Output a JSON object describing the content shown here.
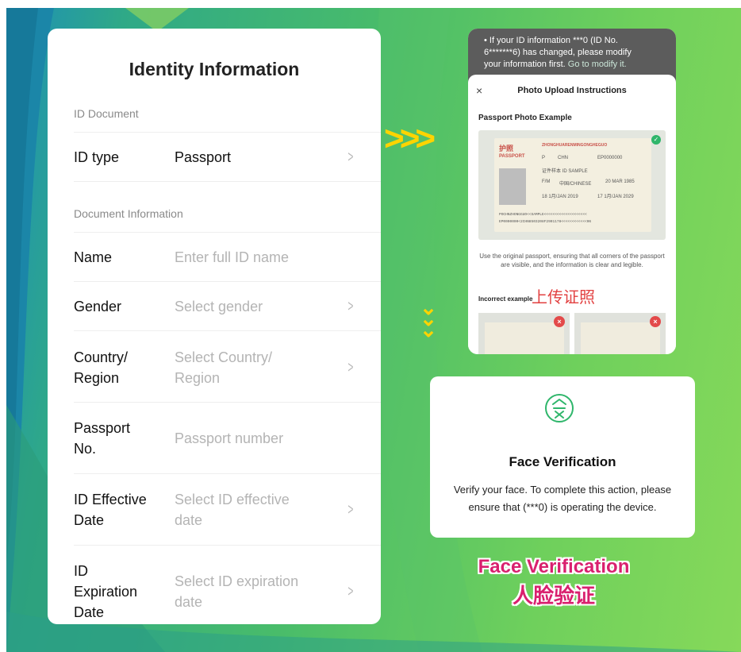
{
  "id_form": {
    "title": "Identity Information",
    "section_id_document": "ID Document",
    "id_type_label": "ID type",
    "id_type_value": "Passport",
    "section_document_info": "Document Information",
    "name_label": "Name",
    "name_placeholder": "Enter full ID name",
    "gender_label": "Gender",
    "gender_placeholder": "Select gender",
    "country_label_1": "Country/",
    "country_label_2": "Region",
    "country_placeholder_1": "Select Country/",
    "country_placeholder_2": "Region",
    "passport_label_1": "Passport",
    "passport_label_2": "No.",
    "passport_placeholder": "Passport number",
    "effective_label_1": "ID Effective",
    "effective_label_2": "Date",
    "effective_placeholder_1": "Select ID effective",
    "effective_placeholder_2": "date",
    "expiration_label_1": "ID",
    "expiration_label_2": "Expiration",
    "expiration_label_3": "Date",
    "expiration_placeholder_1": "Select ID expiration",
    "expiration_placeholder_2": "date",
    "chevron": ">"
  },
  "arrows": {
    "right": ">>>",
    "down": "⌄⌄⌄",
    "color": "#ffd400"
  },
  "upload_sheet": {
    "banner_line1": "If your ID information ***0 (ID No.",
    "banner_line2": "6*******6) has changed, please modify",
    "banner_line3": "your information first.",
    "banner_link": "Go to modify it.",
    "close": "×",
    "title": "Photo Upload Instructions",
    "passport_example": "Passport Photo Example",
    "pp_country": "护照",
    "pp_passport": "PASSPORT",
    "pp_header": "ZHONGHUARENMINGONGHEGUO",
    "pp_type": "P",
    "pp_code": "CHN",
    "pp_number": "EP0000000",
    "pp_name": "证件样本 ID SAMPLE",
    "pp_sex": "F/M",
    "pp_nationality": "中国/CHINESE",
    "pp_birth": "20 MAR 1985",
    "pp_issue": "18 1月/JAN 2019",
    "pp_expiry": "17 1月/JAN 2029",
    "pp_mrz1": "POCHNZHONGGUO<<SAMPLE<<<<<<<<<<<<<<<<<<<<",
    "pp_mrz2": "EP0000000<2CHN8503208F2901178<<<<<<<<<<<<06",
    "description": "Use the original passport, ensuring that all corners of the passport are visible, and the information is clear and legible.",
    "incorrect_example": "Incorrect example",
    "chinese_caption": "上传证照",
    "check_mark": "✓",
    "bad_mark": "×"
  },
  "face_verification": {
    "title": "Face Verification",
    "description": "Verify your face. To complete this action, please ensure that (***0) is operating the device."
  },
  "captions": {
    "face_en": "Face Verification",
    "face_zh": "人脸验证"
  },
  "colors": {
    "accent_green": "#2fb66b",
    "caption_pink": "#d9206e",
    "incorrect_red": "#e34a4a"
  }
}
